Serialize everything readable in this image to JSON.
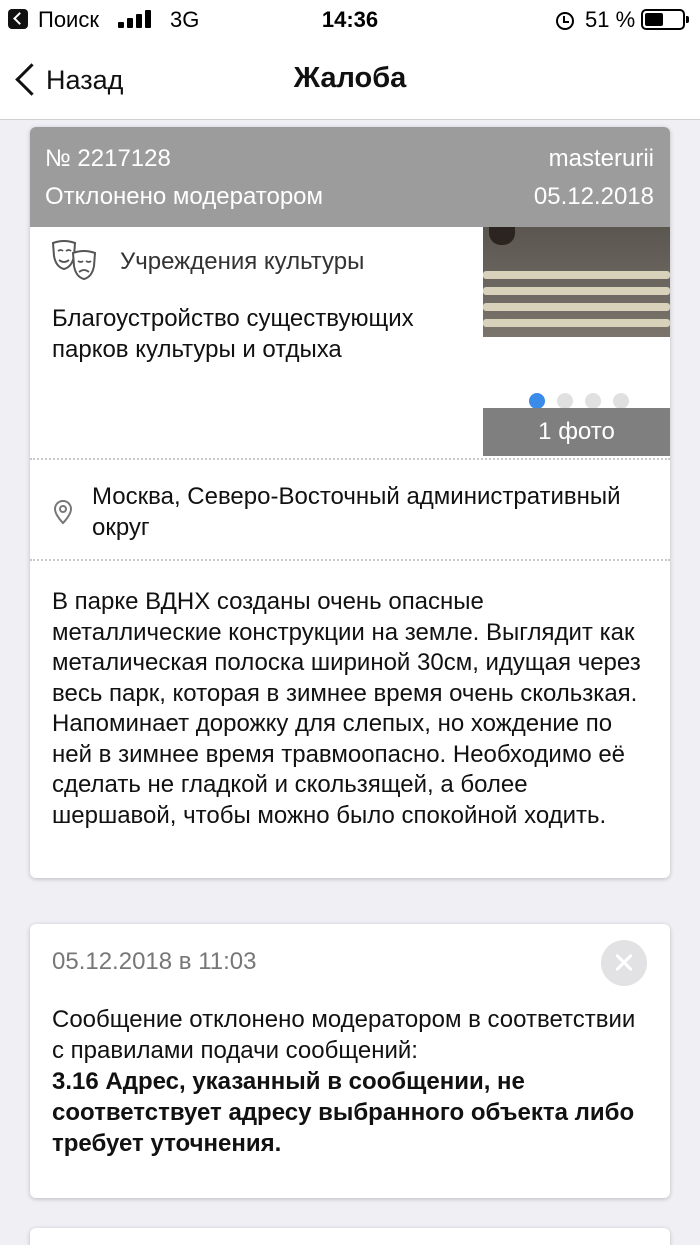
{
  "status_bar": {
    "carrier": "Поиск",
    "network": "3G",
    "time": "14:36",
    "battery": "51 %",
    "battery_level": 0.51
  },
  "nav": {
    "back_label": "Назад",
    "title": "Жалоба"
  },
  "complaint": {
    "number": "№ 2217128",
    "user": "masterurii",
    "status": "Отклонено модератором",
    "date": "05.12.2018",
    "category": "Учреждения культуры",
    "category_icon": "theater-masks-icon",
    "title": "Благоустройство существующих парков культуры и отдыха",
    "photo_label": "1 фото",
    "photo_dots": 4,
    "photo_active_index": 0,
    "address": "Москва, Северо-Восточный административный округ",
    "description": "В парке ВДНХ созданы очень опасные металлические конструкции на земле. Выглядит как металическая полоска шириной 30см, идущая через весь парк, которая в зимнее время очень скользкая. Напоминает дорожку для слепых, но хождение по ней в зимнее время травмоопасно. Необходимо её сделать не гладкой и скользящей, а более шершавой, чтобы можно было спокойной ходить."
  },
  "message": {
    "date": "05.12.2018 в 11:03",
    "text": "Сообщение отклонено модератором в соответствии с правилами подачи сообщений:",
    "reason": "3.16 Адрес, указанный в сообщении, не соответствует адресу выбранного объекта либо требует уточнения."
  },
  "colors": {
    "header_bg": "#9c9c9c",
    "accent_dot": "#3b8be8",
    "background": "#efeff4"
  }
}
